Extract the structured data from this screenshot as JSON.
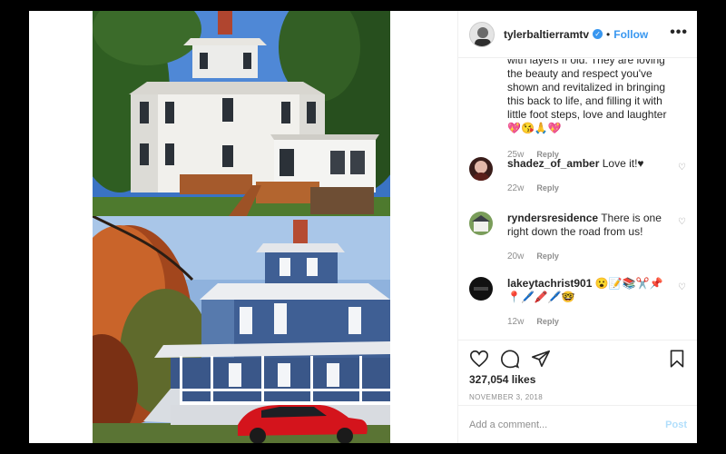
{
  "header": {
    "username": "tylerbaltierramtv",
    "separator": "•",
    "follow_label": "Follow",
    "more_label": "•••",
    "verified_icon": "verified-check-icon"
  },
  "caption": {
    "text": "with layers if old. They are loving the beauty and respect you've shown and revitalized in bringing this back to life, and filling it with little foot steps, love and laughter 💖😘🙏💖",
    "age": "25w",
    "reply_label": "Reply"
  },
  "comments": [
    {
      "user": "shadez_of_amber",
      "text": "Love it!♥",
      "age": "22w",
      "reply_label": "Reply"
    },
    {
      "user": "ryndersresidence",
      "text": "There is one right down the road from us!",
      "age": "20w",
      "reply_label": "Reply"
    },
    {
      "user": "lakeytachrist901",
      "text": "😮📝📚✂️📌📍🖊️🖍️🖊️🤓",
      "age": "12w",
      "reply_label": "Reply"
    }
  ],
  "actions": {
    "icons": [
      "heart-icon",
      "comment-icon",
      "share-icon",
      "bookmark-icon"
    ],
    "likes": "327,054 likes",
    "date": "NOVEMBER 3, 2018"
  },
  "composer": {
    "placeholder": "Add a comment...",
    "post_label": "Post"
  },
  "colors": {
    "accent": "#3897f0",
    "post_disabled": "#b2dffc",
    "secondary_text": "#8e8e8e",
    "car": "#d4141c",
    "house_bottom_siding": "#3f5f94"
  }
}
